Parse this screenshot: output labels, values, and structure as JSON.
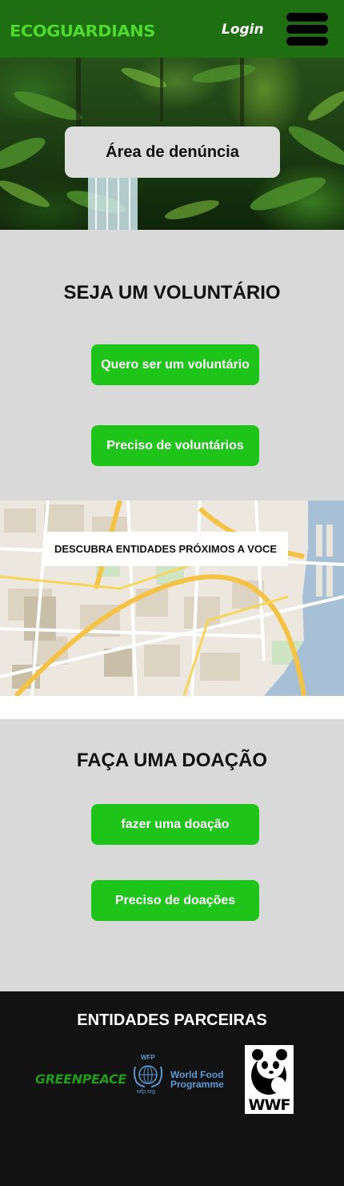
{
  "header": {
    "logo": "ECOGUARDIANS",
    "login": "Login",
    "menu_icon": "hamburger-menu-icon"
  },
  "hero": {
    "report_button": "Área de denúncia"
  },
  "volunteer": {
    "title": "SEJA UM VOLUNTÁRIO",
    "want_button": "Quero ser um voluntário",
    "need_button": "Preciso de voluntários"
  },
  "map": {
    "label": "DESCUBRA ENTIDADES PRÓXIMOS A VOCE"
  },
  "donation": {
    "title": "FAÇA UMA DOAÇÃO",
    "donate_button": "fazer uma doação",
    "need_button": "Preciso de doações"
  },
  "partners": {
    "title": "ENTIDADES PARCEIRAS",
    "logos": {
      "greenpeace": "GREENPEACE",
      "wfp_abbr": "WFP",
      "wfp_name": "World Food Programme",
      "wfp_url": "wfp.org",
      "wwf": "WWF"
    }
  },
  "colors": {
    "header_bg": "#1e6e12",
    "logo": "#4fd82e",
    "button_green": "#1ec41a",
    "section_gray": "#d9d9d9",
    "footer_bg": "#121212"
  }
}
